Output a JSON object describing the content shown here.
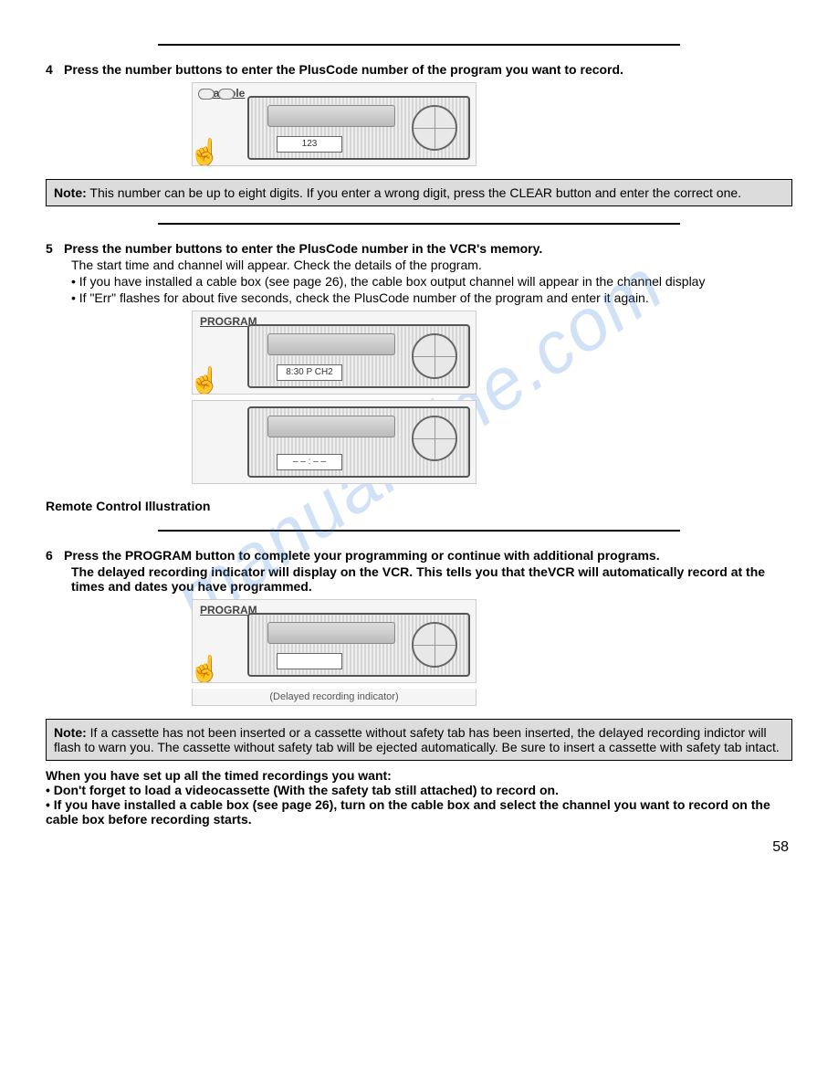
{
  "watermark": "manualsline.com",
  "page_number": "58",
  "rule_count": 3,
  "steps": {
    "s4": {
      "num": "4",
      "title": "Press the number buttons to enter the PlusCode number of the program you want to record.",
      "illus_label": "Example",
      "illus_display": "123"
    },
    "note4": {
      "label": "Note:",
      "text": " This number can be up to eight digits. If you enter a wrong digit, press the CLEAR button and enter the correct one."
    },
    "s5": {
      "num": "5",
      "title": "Press the number buttons to enter the PlusCode number in the VCR's memory.",
      "line1": "The start time and channel will appear. Check the details of the program.",
      "bullet1": "• If you have installed a cable box (see page 26), the cable box output channel will appear in the channel display",
      "bullet2": "• If \"Err\" flashes for about five seconds, check the PlusCode number of the program and enter it again.",
      "illus_label": "PROGRAM",
      "illus_display_a": "8:30 P CH2",
      "illus_display_b": "– – : – –"
    },
    "remote_heading": "Remote Control Illustration",
    "s6": {
      "num": "6",
      "title": "Press the PROGRAM button to complete your programming or continue with additional programs.",
      "line1": "The delayed recording indicator will display on the VCR. This tells you that theVCR will automatically record at the times and dates you have programmed.",
      "illus_label": "PROGRAM",
      "illus_display": "",
      "illus_caption": "(Delayed recording indicator)"
    },
    "note6": {
      "label": "Note:",
      "text": " If a cassette has not been inserted or a cassette without safety tab has been inserted, the delayed recording indictor will flash to warn you. The cassette without safety tab will be ejected automatically. Be sure to insert a cassette with safety tab intact."
    },
    "closing": {
      "heading": "When you have set up all the timed recordings you want:",
      "b1": "• Don't forget to load a videocassette (With the safety tab still attached) to record on.",
      "b2": "• If you have installed a cable box (see page 26), turn on the cable box and select the channel you want to record on the cable box before recording starts."
    }
  }
}
